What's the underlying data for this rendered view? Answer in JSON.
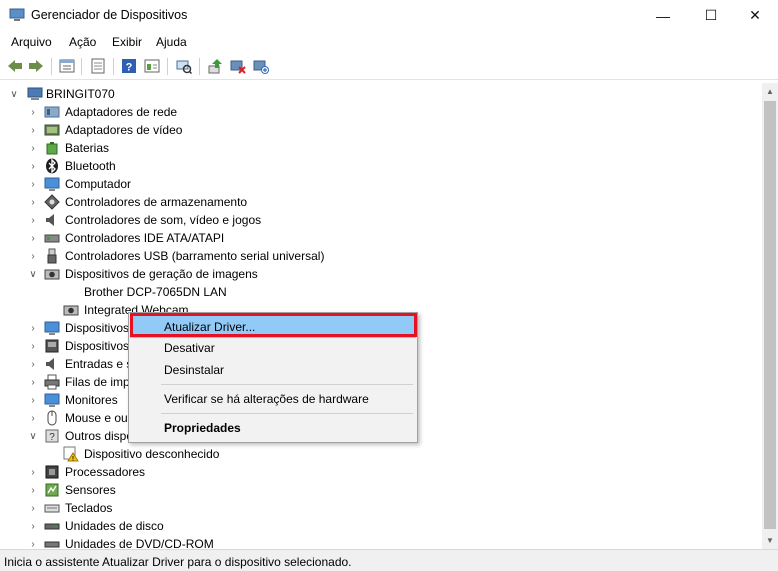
{
  "window": {
    "title": "Gerenciador de Dispositivos",
    "minimize_glyph": "—",
    "maximize_glyph": "☐",
    "close_glyph": "✕"
  },
  "menu": [
    "Arquivo",
    "Ação",
    "Exibir",
    "Ajuda"
  ],
  "toolbar": {
    "buttons": [
      "back-arrow-icon",
      "forward-arrow-icon",
      "properties-icon",
      "console-icon",
      "help-icon",
      "view-icon",
      "scan-icon",
      "update-driver-icon",
      "disable-device-icon",
      "uninstall-device-icon"
    ]
  },
  "tree": {
    "root": "BRINGIT070",
    "categories": [
      "Adaptadores de rede",
      "Adaptadores de vídeo",
      "Baterias",
      "Bluetooth",
      "Computador",
      "Controladores de armazenamento",
      "Controladores de som, vídeo e jogos",
      "Controladores IDE ATA/ATAPI",
      "Controladores USB (barramento serial universal)",
      "Dispositivos de geração de imagens",
      "Dispositivos",
      "Dispositivos",
      "Entradas e s",
      "Filas de imp",
      "Monitores",
      "Mouse e out",
      "Outros dispo",
      "Processadores",
      "Sensores",
      "Teclados",
      "Unidades de disco",
      "Unidades de DVD/CD-ROM"
    ],
    "imaging_children": [
      "Brother DCP-7065DN LAN",
      "Integrated Webcam"
    ],
    "other_children": [
      "Dispositivo desconhecido"
    ]
  },
  "context_menu": {
    "items": [
      "Atualizar Driver...",
      "Desativar",
      "Desinstalar",
      "Verificar se há alterações de hardware",
      "Propriedades"
    ]
  },
  "status": "Inicia o assistente Atualizar Driver para o dispositivo selecionado.",
  "colors": {
    "highlight": "#91c9f7",
    "annotation": "#e81123"
  }
}
